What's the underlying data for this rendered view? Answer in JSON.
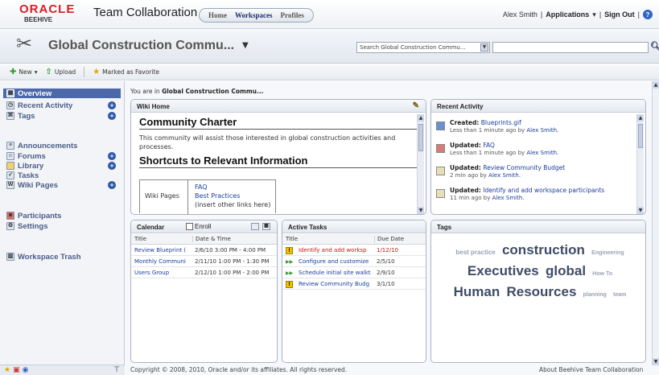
{
  "header": {
    "logo_text": "ORACLE",
    "logo_sub": "BEEHIVE",
    "app_title": "Team Collaboration",
    "nav": [
      "Home",
      "Workspaces",
      "Profiles"
    ],
    "user": "Alex Smith",
    "applications": "Applications",
    "signout": "Sign Out"
  },
  "workspace": {
    "title": "Global Construction Commu...",
    "search_scope": "Search Global Construction Commu...",
    "search_value": ""
  },
  "toolbar": {
    "new": "New",
    "upload": "Upload",
    "favorite": "Marked as Favorite"
  },
  "sidebar": {
    "overview": "Overview",
    "recent": "Recent Activity",
    "tags": "Tags",
    "announcements": "Announcements",
    "forums": "Forums",
    "library": "Library",
    "tasks": "Tasks",
    "wiki": "Wiki Pages",
    "participants": "Participants",
    "settings": "Settings",
    "trash": "Workspace Trash"
  },
  "breadcrumb": {
    "prefix": "You are in",
    "location": "Global Construction Commu..."
  },
  "wiki": {
    "title": "Wiki Home",
    "h1": "Community Charter",
    "p1": "This community will assist those interested in global construction activities and processes.",
    "h2": "Shortcuts to Relevant Information",
    "tbl_label": "Wiki Pages",
    "links": [
      "FAQ",
      "Best Practices",
      "(insert other links here)"
    ]
  },
  "recent": {
    "title": "Recent Activity",
    "items": [
      {
        "action": "Created:",
        "target": "Blueprints.gif",
        "time": "Less than 1 minute ago by",
        "user": "Alex Smith."
      },
      {
        "action": "Updated:",
        "target": "FAQ",
        "time": "Less than 1 minute ago by",
        "user": "Alex Smith."
      },
      {
        "action": "Updated:",
        "target": "Review Community Budget",
        "time": "2 min ago by",
        "user": "Alex Smith."
      },
      {
        "action": "Updated:",
        "target": "Identify and add workspace participants",
        "time": "11 min ago by",
        "user": "Alex Smith."
      }
    ]
  },
  "calendar": {
    "title": "Calendar",
    "enroll": "Enroll",
    "col_title": "Title",
    "col_date": "Date & Time",
    "rows": [
      {
        "title": "Review Blueprint (",
        "date": "2/6/10 3:00 PM - 4:00 PM"
      },
      {
        "title": "Monthly Communi",
        "date": "2/11/10 1:00 PM - 1:30 PM"
      },
      {
        "title": "Users Group",
        "date": "2/12/10 1:00 PM - 2:00 PM"
      }
    ]
  },
  "tasks": {
    "title": "Active Tasks",
    "col_title": "Title",
    "col_due": "Due Date",
    "rows": [
      {
        "icon": "!",
        "title": "Identify and add worksp",
        "due": "1/12/10",
        "overdue": true
      },
      {
        "icon": "▶▶",
        "title": "Configure and customize",
        "due": "2/5/10",
        "overdue": false
      },
      {
        "icon": "▶▶",
        "title": "Schedule initial site walkt",
        "due": "2/9/10",
        "overdue": false
      },
      {
        "icon": "!",
        "title": "Review Community Budg",
        "due": "3/1/10",
        "overdue": false
      }
    ]
  },
  "tagspanel": {
    "title": "Tags",
    "tags": [
      {
        "t": "best practice",
        "size": 8,
        "color": "#9aa3b6"
      },
      {
        "t": "construction",
        "size": 17,
        "color": "#3f4c66"
      },
      {
        "t": "Engineering",
        "size": 7,
        "color": "#9aa3b6"
      },
      {
        "t": "Executives",
        "size": 17,
        "color": "#3f4c66"
      },
      {
        "t": "global",
        "size": 17,
        "color": "#3f4c66"
      },
      {
        "t": "How To",
        "size": 7,
        "color": "#9aa3b6"
      },
      {
        "t": "Human",
        "size": 17,
        "color": "#3f4c66"
      },
      {
        "t": "Resources",
        "size": 17,
        "color": "#3f4c66"
      },
      {
        "t": "planning",
        "size": 7,
        "color": "#9aa3b6"
      },
      {
        "t": "team",
        "size": 7,
        "color": "#9aa3b6"
      }
    ]
  },
  "footer": {
    "copyright": "Copyright © 2008, 2010, Oracle and/or its affiliates. All rights reserved.",
    "about": "About Beehive Team Collaboration"
  }
}
